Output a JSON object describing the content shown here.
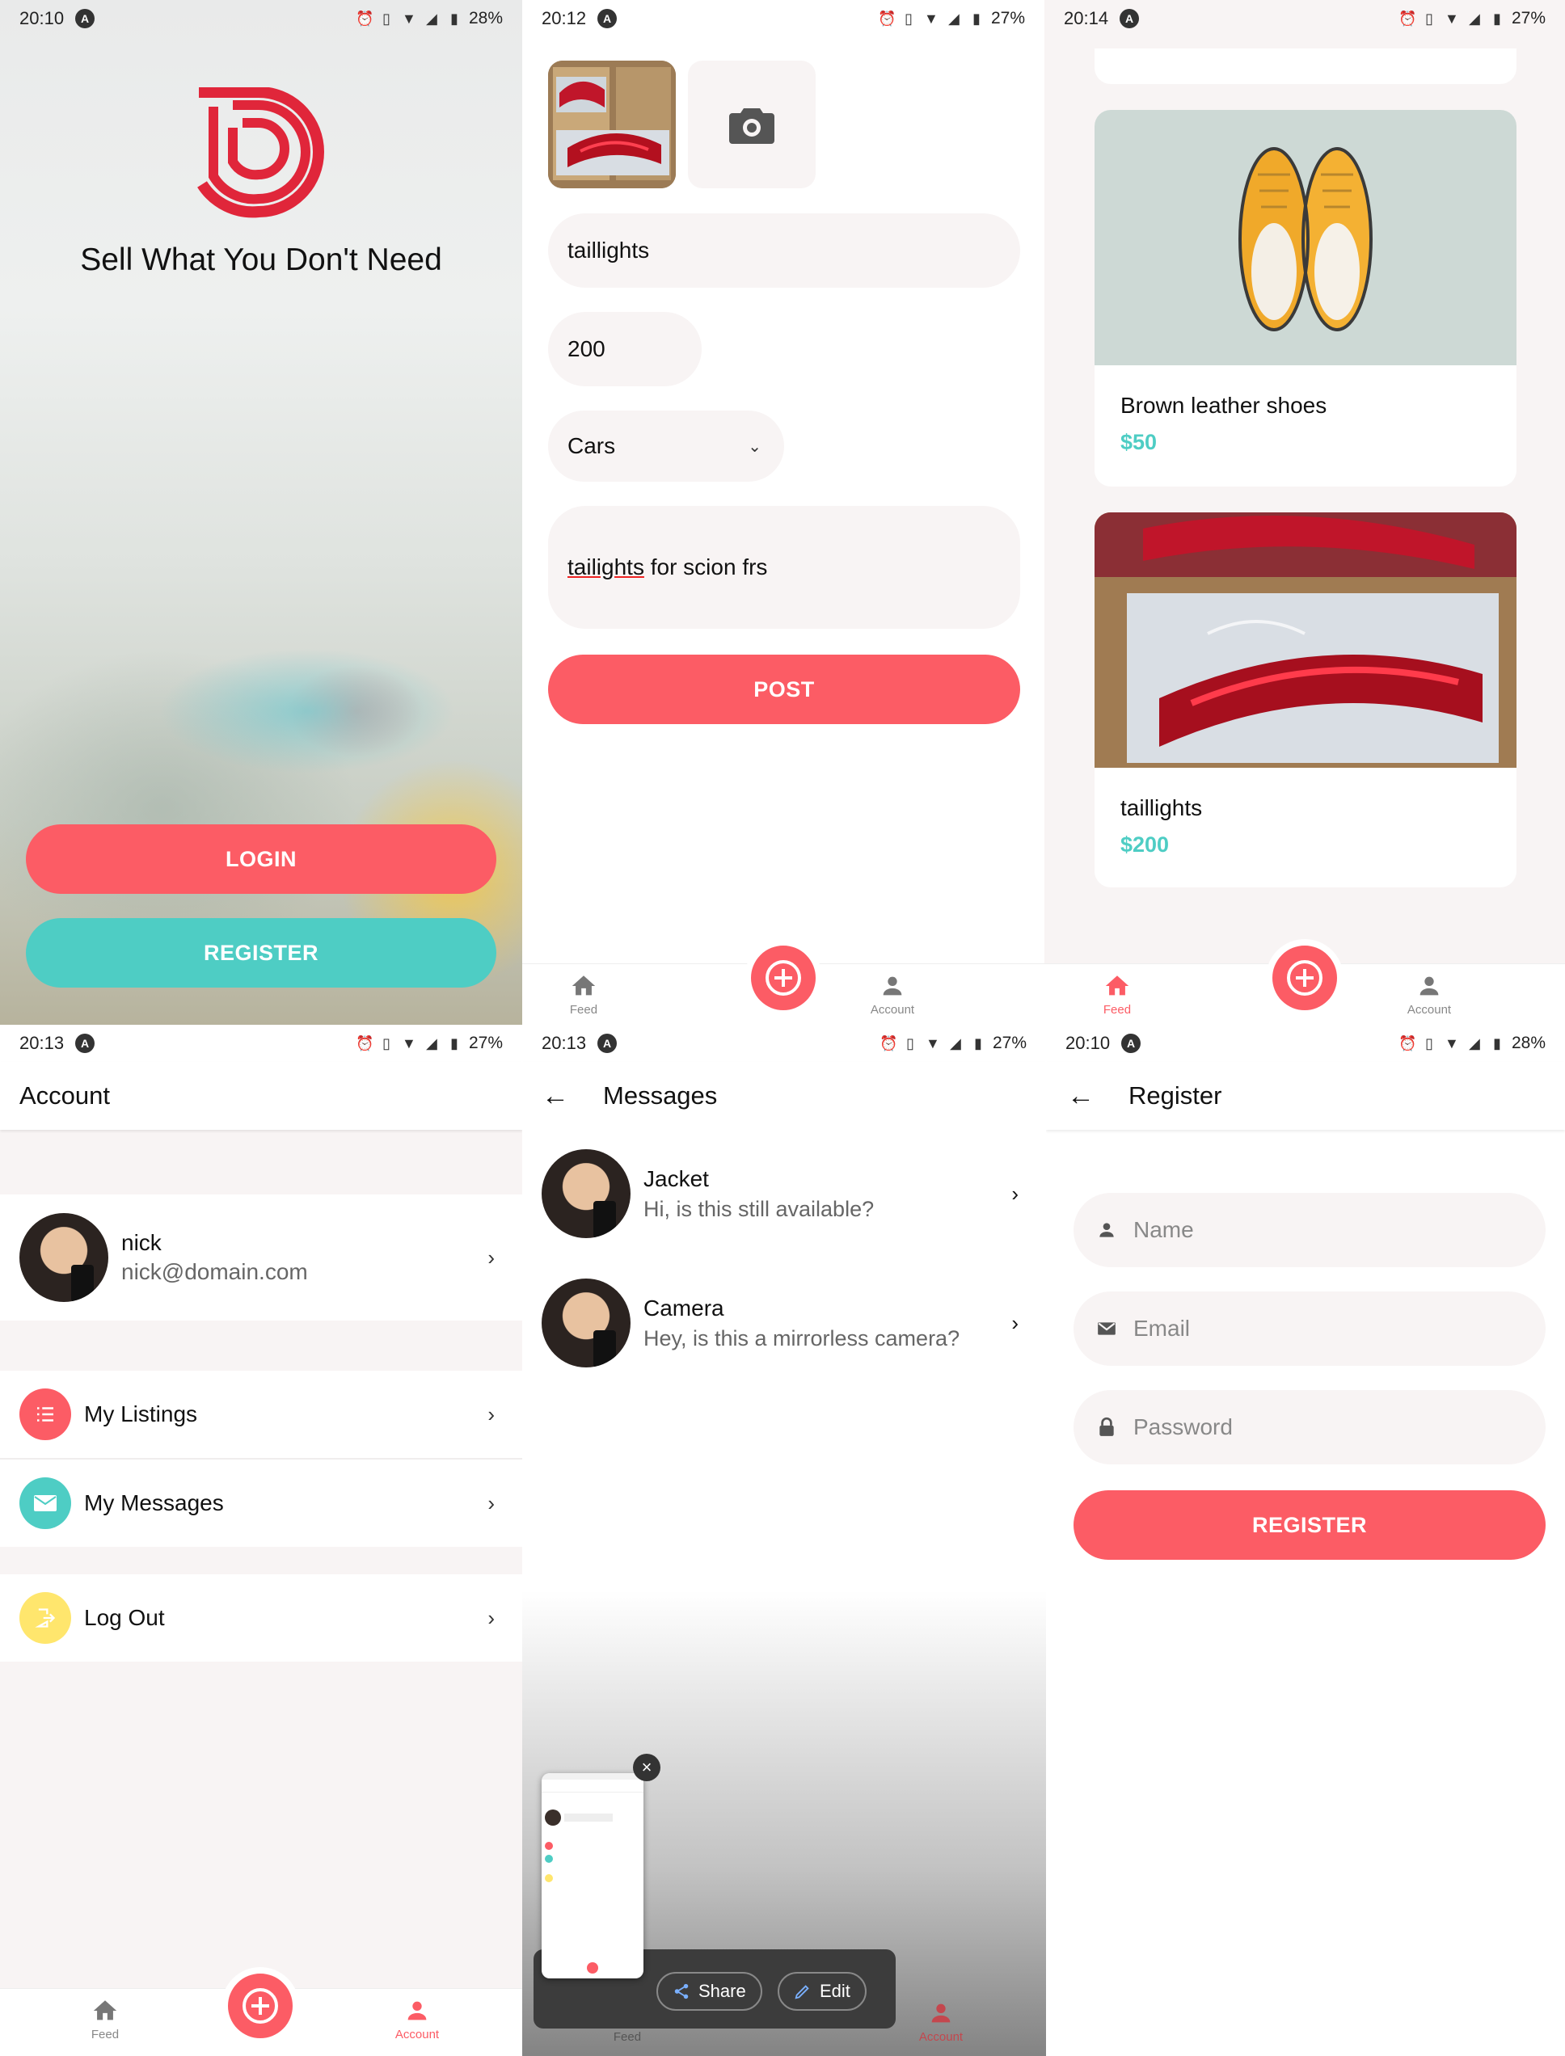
{
  "status_bars": {
    "p1": {
      "time": "20:10",
      "battery": "28%"
    },
    "p2": {
      "time": "20:12",
      "battery": "27%"
    },
    "p3": {
      "time": "20:14",
      "battery": "27%"
    },
    "p4": {
      "time": "20:13",
      "battery": "27%"
    },
    "p5": {
      "time": "20:13",
      "battery": "27%"
    },
    "p6": {
      "time": "20:10",
      "battery": "28%"
    }
  },
  "welcome": {
    "tagline": "Sell What You Don't Need",
    "login_label": "LOGIN",
    "register_label": "REGISTER"
  },
  "listing_edit": {
    "title_value": "taillights",
    "price_value": "200",
    "category_value": "Cars",
    "description_word1": "tailights",
    "description_rest": " for scion frs",
    "post_label": "POST"
  },
  "nav": {
    "feed_label": "Feed",
    "account_label": "Account"
  },
  "feed": {
    "listings": [
      {
        "title": "Brown leather shoes",
        "price": "$50"
      },
      {
        "title": "taillights",
        "price": "$200"
      }
    ]
  },
  "account": {
    "title": "Account",
    "user_name": "nick",
    "user_email": "nick@domain.com",
    "menu": [
      {
        "label": "My Listings",
        "color": "#fc5c65"
      },
      {
        "label": "My Messages",
        "color": "#4ecdc4"
      },
      {
        "label": "Log Out",
        "color": "#ffe66d"
      }
    ]
  },
  "messages": {
    "title": "Messages",
    "items": [
      {
        "title": "Jacket",
        "text": "Hi, is this still available?"
      },
      {
        "title": "Camera",
        "text": "Hey, is this a mirrorless camera?"
      }
    ],
    "share_label": "Share",
    "edit_label": "Edit"
  },
  "register": {
    "title": "Register",
    "name_placeholder": "Name",
    "email_placeholder": "Email",
    "password_placeholder": "Password",
    "button_label": "REGISTER"
  },
  "colors": {
    "primary": "#fc5c65",
    "secondary": "#4ecdc4",
    "light": "#f8f4f4",
    "warning": "#ffe66d"
  }
}
